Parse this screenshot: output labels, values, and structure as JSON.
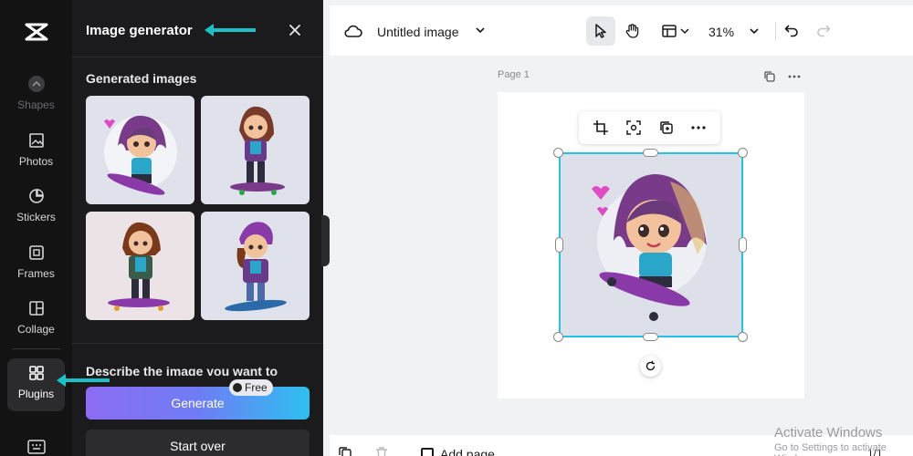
{
  "rail": {
    "items": [
      {
        "label": "Shapes",
        "icon": "shapes-icon"
      },
      {
        "label": "Photos",
        "icon": "photos-icon"
      },
      {
        "label": "Stickers",
        "icon": "stickers-icon"
      },
      {
        "label": "Frames",
        "icon": "frames-icon"
      },
      {
        "label": "Collage",
        "icon": "collage-icon"
      },
      {
        "label": "Plugins",
        "icon": "plugins-icon"
      }
    ]
  },
  "panel": {
    "title": "Image generator",
    "section_title": "Generated images",
    "prompt_label": "Describe the image you want to",
    "generate_label": "Generate",
    "free_badge": "Free",
    "start_over_label": "Start over"
  },
  "topbar": {
    "doc_title": "Untitled image",
    "zoom": "31%"
  },
  "canvas": {
    "page_label": "Page 1"
  },
  "bottombar": {
    "add_page_label": "Add page",
    "page_count": "1/1"
  },
  "watermark": {
    "line1": "Activate Windows",
    "line2": "Go to Settings to activate Windows."
  },
  "colors": {
    "accent": "#22c3e6",
    "annotation_arrow": "#19c2c9",
    "generate_gradient_start": "#8c6cf3",
    "generate_gradient_end": "#2ec0ef"
  }
}
